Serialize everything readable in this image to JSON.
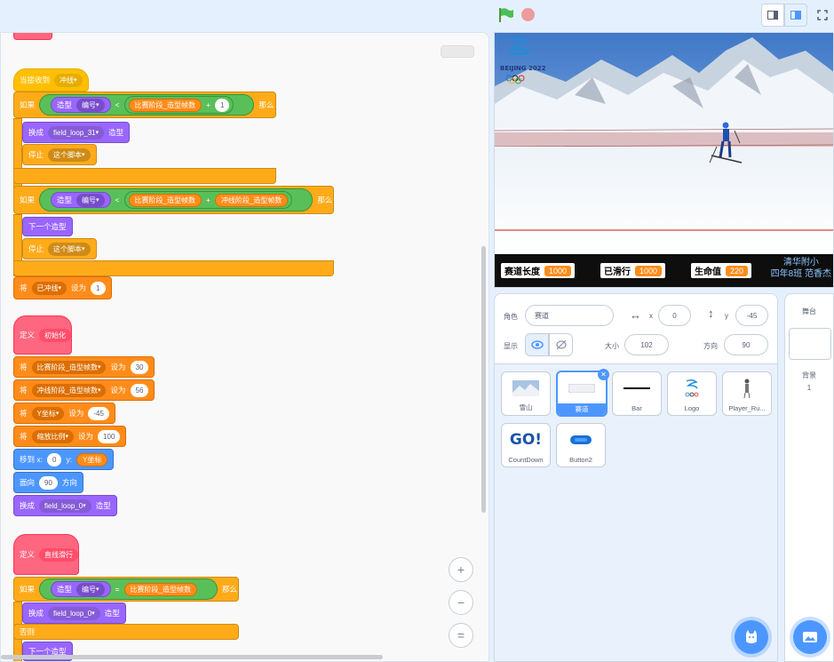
{
  "code": {
    "top_partial": "",
    "s1_hat": "当接收到",
    "s1_msg": "冲线",
    "if_label": "如果",
    "then_label": "那么",
    "sensing_costume": "造型",
    "sensing_number": "编号",
    "lt": "<",
    "plus": "+",
    "eq": "=",
    "var_stage1_frames": "比赛阶段_造型帧数",
    "var_sprint_frames": "冲线阶段_造型帧数",
    "num_1": "1",
    "switch_costume": "换成",
    "costume_suffix": "造型",
    "costume_31": "field_loop_31",
    "costume_0": "field_loop_0",
    "stop_label": "停止",
    "stop_option": "这个脚本",
    "next_costume": "下一个造型",
    "set_label": "将",
    "set_to": "设为",
    "var_crossed": "已冲线",
    "val_1": "1",
    "define_label": "定义",
    "def_init": "初始化",
    "val_30": "30",
    "val_56": "56",
    "var_y": "Y坐标",
    "val_m45": "-45",
    "var_scale": "缩放比例",
    "val_100": "100",
    "goto_x": "移到 x:",
    "goto_y": "y:",
    "val_0": "0",
    "point_label": "面向",
    "point_dir": "方向",
    "val_90": "90",
    "def_slide": "直线滑行",
    "else_label": "否则"
  },
  "zoom": {
    "in": "+",
    "out": "−",
    "reset": "="
  },
  "stage": {
    "logo_text": "BEIJING 2022",
    "hud": {
      "track_length_label": "赛道长度",
      "track_length_value": "1000",
      "traveled_label": "已滑行",
      "traveled_value": "1000",
      "life_label": "生命值",
      "life_value": "220"
    },
    "credit_line1": "清华附小",
    "credit_line2": "四年8班 范香杰"
  },
  "sprite_info": {
    "sprite_label": "角色",
    "sprite_name": "赛道",
    "x_label": "x",
    "x_value": "0",
    "y_label": "y",
    "y_value": "-45",
    "show_label": "显示",
    "size_label": "大小",
    "size_value": "102",
    "direction_label": "方向",
    "direction_value": "90"
  },
  "sprites": [
    {
      "name": "雪山"
    },
    {
      "name": "赛道"
    },
    {
      "name": "Bar"
    },
    {
      "name": "Logo"
    },
    {
      "name": "Player_Ru..."
    },
    {
      "name": "CountDown"
    },
    {
      "name": "Button2"
    }
  ],
  "countdown_thumb": "GO!",
  "stage_panel": {
    "title": "舞台",
    "backdrop_label": "背景",
    "backdrop_count": "1"
  },
  "colors": {
    "events": "#ffbf00",
    "control": "#ffab19",
    "looks": "#9966ff",
    "data": "#ff8c1a",
    "motion": "#4c97ff",
    "myblocks": "#ff6680",
    "operators": "#59c059"
  }
}
